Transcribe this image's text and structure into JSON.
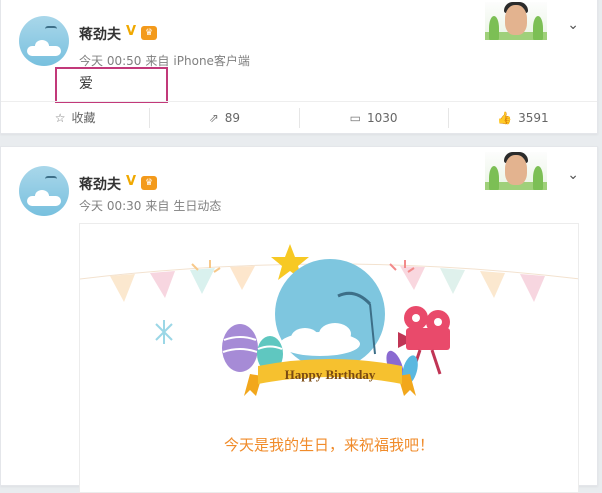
{
  "post1": {
    "author": "蒋劲夫",
    "time": "今天 00:50",
    "source_prefix": "来自",
    "source": "iPhone客户端",
    "content": "爱",
    "actions": {
      "favorite": "收藏",
      "repost": "89",
      "comment": "1030",
      "like": "3591"
    }
  },
  "post2": {
    "author": "蒋劲夫",
    "time": "今天 00:30",
    "source_prefix": "来自",
    "source": "生日动态",
    "banner_text": "Happy Birthday",
    "card_text": "今天是我的生日，来祝福我吧！"
  },
  "colors": {
    "highlight": "#c2397a",
    "birthday_text": "#f08b2a",
    "verified": "#f0a800"
  },
  "icons": {
    "favorite": "star-outline-icon",
    "repost": "share-arrow-icon",
    "comment": "comment-bubble-icon",
    "like": "thumb-up-icon",
    "more": "chevron-down-icon"
  }
}
